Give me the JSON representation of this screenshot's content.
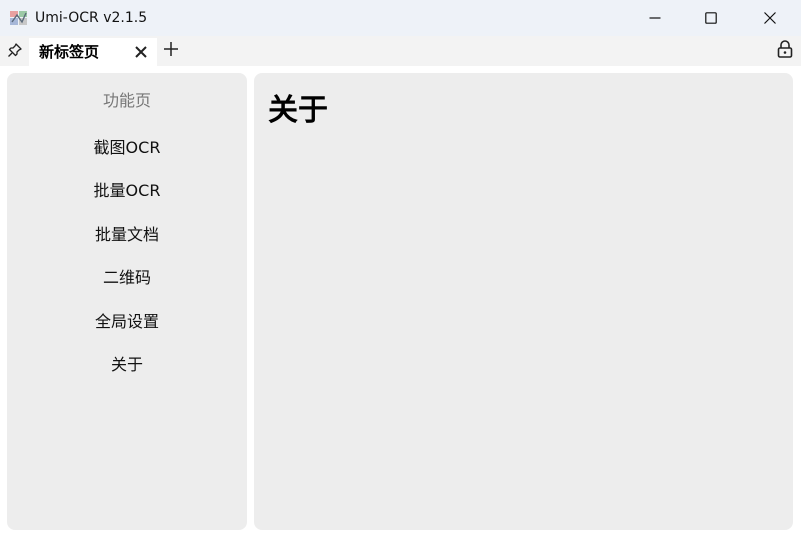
{
  "window": {
    "title": "Umi-OCR v2.1.5",
    "app_icon": "umi-ocr-logo-icon",
    "controls": [
      "minimize-icon",
      "maximize-icon",
      "close-icon"
    ]
  },
  "tabbar": {
    "pin_icon": "pin-icon",
    "tabs": [
      {
        "label": "新标签页",
        "active": true,
        "close_icon": "close-icon"
      }
    ],
    "add_icon": "plus-icon",
    "lock_icon": "lock-icon"
  },
  "sidebar": {
    "header": "功能页",
    "items": [
      {
        "label": "截图OCR"
      },
      {
        "label": "批量OCR"
      },
      {
        "label": "批量文档"
      },
      {
        "label": "二维码"
      },
      {
        "label": "全局设置"
      },
      {
        "label": "关于"
      }
    ]
  },
  "main": {
    "title": "关于"
  },
  "colors": {
    "titlebar_bg": "#eef2f8",
    "tabbar_bg": "#f3f3f3",
    "panel_bg": "#ededed",
    "header_text": "#777777"
  }
}
